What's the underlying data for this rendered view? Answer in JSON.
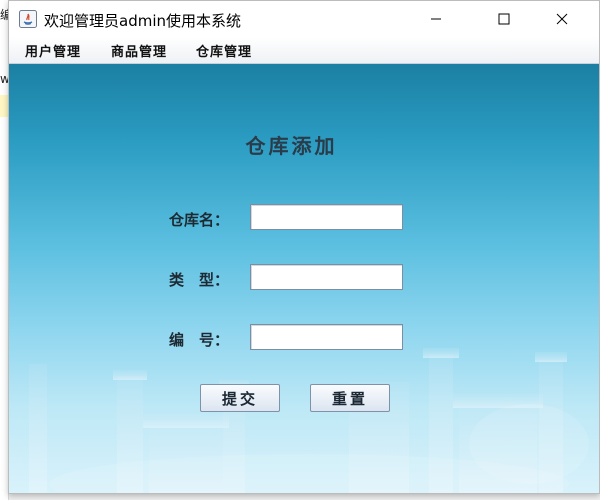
{
  "desktop": {
    "fragment_top": "编",
    "fragment_mid": "w"
  },
  "window": {
    "title": "欢迎管理员admin使用本系统",
    "icon": "java-app-icon",
    "controls": [
      "minimize-icon",
      "maximize-icon",
      "close-icon"
    ]
  },
  "menubar": {
    "items": [
      {
        "label": "用户管理"
      },
      {
        "label": "商品管理"
      },
      {
        "label": "仓库管理"
      }
    ]
  },
  "form": {
    "title": "仓库添加",
    "fields": [
      {
        "label": "仓库名：",
        "value": ""
      },
      {
        "label": "类　型：",
        "value": ""
      },
      {
        "label": "编　号：",
        "value": ""
      }
    ],
    "submit_label": "提交",
    "reset_label": "重置"
  },
  "colors": {
    "background_top": "#1b7fa3",
    "background_bottom": "#d9f2fb",
    "title_color": "#2a3c4a"
  }
}
